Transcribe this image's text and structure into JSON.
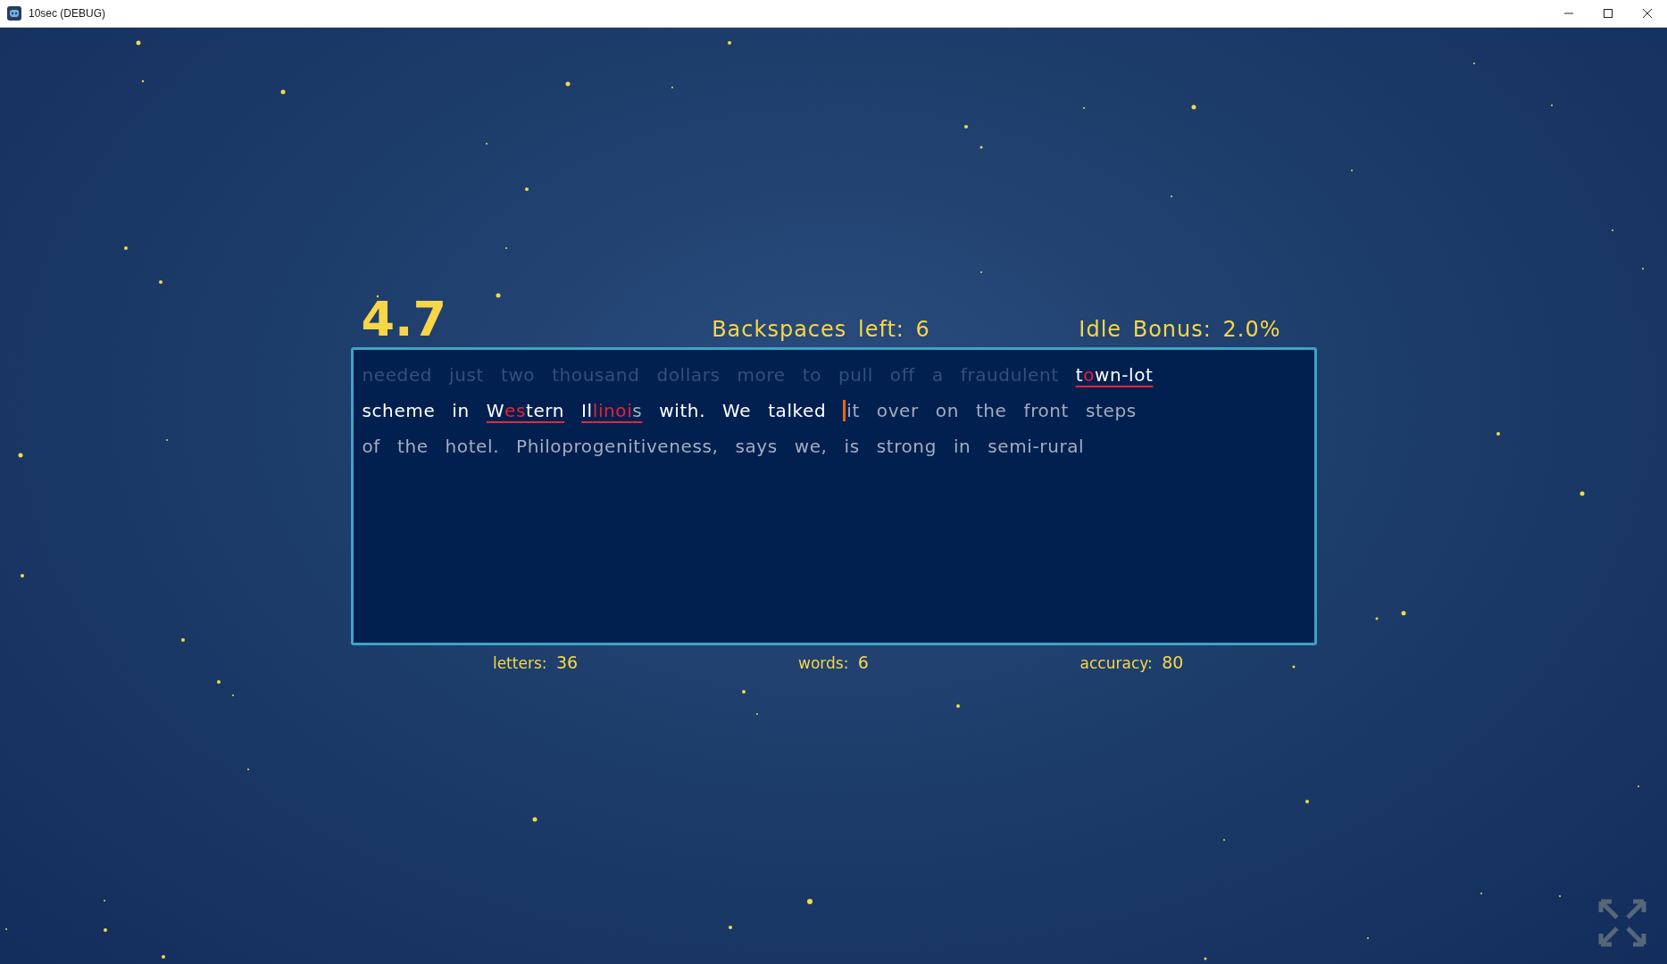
{
  "window": {
    "title": "10sec (DEBUG)"
  },
  "timer": "4.7",
  "backspaces": {
    "label": "Backspaces left:",
    "value": "6"
  },
  "idle_bonus": {
    "label": "Idle Bonus:",
    "value": "2.0%"
  },
  "passage": {
    "lines": [
      {
        "words": [
          {
            "segments": [
              {
                "text": "needed",
                "kind": "faded"
              }
            ]
          },
          {
            "segments": [
              {
                "text": "just",
                "kind": "faded"
              }
            ]
          },
          {
            "segments": [
              {
                "text": "two",
                "kind": "faded"
              }
            ]
          },
          {
            "segments": [
              {
                "text": "thousand",
                "kind": "faded"
              }
            ]
          },
          {
            "segments": [
              {
                "text": "dollars",
                "kind": "faded"
              }
            ]
          },
          {
            "segments": [
              {
                "text": "more",
                "kind": "faded"
              }
            ]
          },
          {
            "segments": [
              {
                "text": "to",
                "kind": "faded"
              }
            ]
          },
          {
            "segments": [
              {
                "text": "pull",
                "kind": "faded"
              }
            ]
          },
          {
            "segments": [
              {
                "text": "off",
                "kind": "faded"
              }
            ]
          },
          {
            "segments": [
              {
                "text": "a",
                "kind": "faded"
              }
            ]
          },
          {
            "segments": [
              {
                "text": "fraudulent",
                "kind": "faded"
              }
            ]
          },
          {
            "underlined": true,
            "segments": [
              {
                "text": "t",
                "kind": "correct"
              },
              {
                "text": "o",
                "kind": "wrong"
              },
              {
                "text": "wn-lot",
                "kind": "correct"
              }
            ]
          }
        ]
      },
      {
        "words": [
          {
            "segments": [
              {
                "text": "scheme",
                "kind": "correct"
              }
            ]
          },
          {
            "segments": [
              {
                "text": "in",
                "kind": "correct"
              }
            ]
          },
          {
            "underlined": true,
            "segments": [
              {
                "text": "W",
                "kind": "correct"
              },
              {
                "text": "es",
                "kind": "wrong"
              },
              {
                "text": "tern",
                "kind": "correct"
              }
            ]
          },
          {
            "underlined": true,
            "segments": [
              {
                "text": "Il",
                "kind": "correct"
              },
              {
                "text": "linoi",
                "kind": "wrong"
              },
              {
                "text": "s",
                "kind": "pending"
              }
            ]
          },
          {
            "segments": [
              {
                "text": "with.",
                "kind": "correct"
              }
            ]
          },
          {
            "segments": [
              {
                "text": "We",
                "kind": "correct"
              }
            ]
          },
          {
            "segments": [
              {
                "text": "talked",
                "kind": "correct"
              }
            ]
          },
          {
            "cursor": true,
            "segments": [
              {
                "text": "it",
                "kind": "pending"
              }
            ]
          },
          {
            "segments": [
              {
                "text": "over",
                "kind": "pending"
              }
            ]
          },
          {
            "segments": [
              {
                "text": "on",
                "kind": "pending"
              }
            ]
          },
          {
            "segments": [
              {
                "text": "the",
                "kind": "pending"
              }
            ]
          },
          {
            "segments": [
              {
                "text": "front",
                "kind": "pending"
              }
            ]
          },
          {
            "segments": [
              {
                "text": "steps",
                "kind": "pending"
              }
            ]
          }
        ]
      },
      {
        "words": [
          {
            "segments": [
              {
                "text": "of",
                "kind": "pending"
              }
            ]
          },
          {
            "segments": [
              {
                "text": "the",
                "kind": "pending"
              }
            ]
          },
          {
            "segments": [
              {
                "text": "hotel.",
                "kind": "pending"
              }
            ]
          },
          {
            "segments": [
              {
                "text": "Philoprogenitiveness,",
                "kind": "pending"
              }
            ]
          },
          {
            "segments": [
              {
                "text": "says",
                "kind": "pending"
              }
            ]
          },
          {
            "segments": [
              {
                "text": "we,",
                "kind": "pending"
              }
            ]
          },
          {
            "segments": [
              {
                "text": "is",
                "kind": "pending"
              }
            ]
          },
          {
            "segments": [
              {
                "text": "strong",
                "kind": "pending"
              }
            ]
          },
          {
            "segments": [
              {
                "text": "in",
                "kind": "pending"
              }
            ]
          },
          {
            "segments": [
              {
                "text": "semi-rural",
                "kind": "pending"
              }
            ]
          }
        ]
      }
    ]
  },
  "stats": [
    {
      "label": "letters:",
      "value": "36"
    },
    {
      "label": "words:",
      "value": "6"
    },
    {
      "label": "accuracy:",
      "value": "80"
    }
  ]
}
